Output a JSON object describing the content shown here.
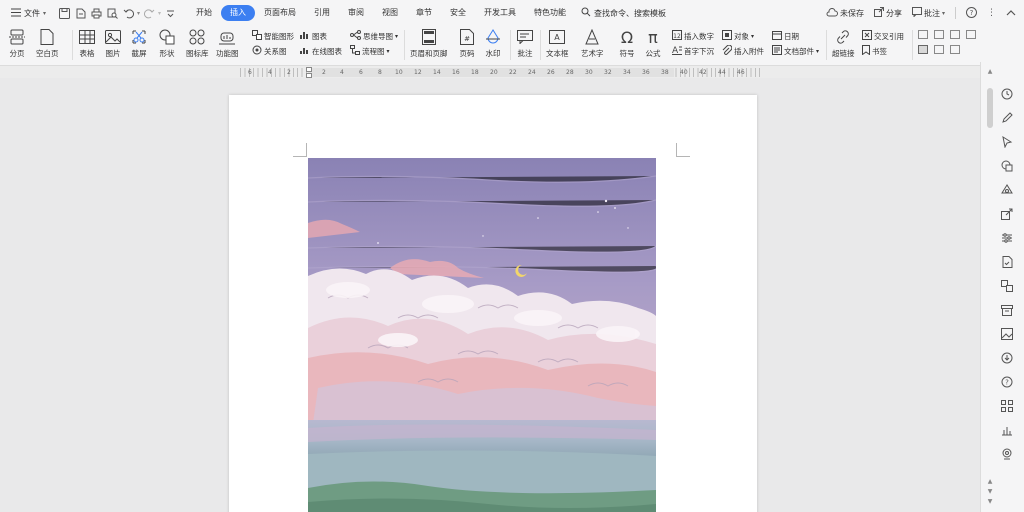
{
  "menu": {
    "file": "文件",
    "tabs": [
      "开始",
      "插入",
      "页面布局",
      "引用",
      "审阅",
      "视图",
      "章节",
      "安全",
      "开发工具",
      "特色功能"
    ],
    "active_tab": 1,
    "search": "查找命令、搜索模板",
    "unsaved": "未保存",
    "share": "分享",
    "comment": "批注"
  },
  "ribbon": {
    "page_break": "分页",
    "blank_page": "空白页",
    "table": "表格",
    "picture": "图片",
    "screenshot": "截屏",
    "shape": "形状",
    "icon_lib": "图标库",
    "func_chart": "功能图",
    "smart_shape": "智能图形",
    "chart": "图表",
    "mind_map": "思维导图",
    "relation": "关系图",
    "online_chart": "在线图表",
    "flow_chart": "流程图",
    "header_footer": "页眉和页脚",
    "page_number": "页码",
    "watermark": "水印",
    "annotation": "批注",
    "textbox": "文本框",
    "wordart": "艺术字",
    "symbol": "符号",
    "formula": "公式",
    "insert_number": "插入数字",
    "object": "对象",
    "date": "日期",
    "drop_cap": "首字下沉",
    "attachment": "插入附件",
    "doc_parts": "文档部件",
    "hyperlink": "超链接",
    "cross_ref": "交叉引用",
    "bookmark": "书签"
  },
  "ruler": [
    "6",
    "4",
    "2",
    "2",
    "4",
    "6",
    "8",
    "10",
    "12",
    "14",
    "16",
    "18",
    "20",
    "22",
    "24",
    "26",
    "28",
    "30",
    "32",
    "34",
    "36",
    "38",
    "40",
    "42",
    "44",
    "46"
  ],
  "colors": {
    "accent": "#3c7ff1",
    "sky_top": "#8a82b4",
    "sky_mid": "#a79bc6",
    "cloud_pink": "#e9b4b9",
    "moon": "#f2d66b"
  }
}
